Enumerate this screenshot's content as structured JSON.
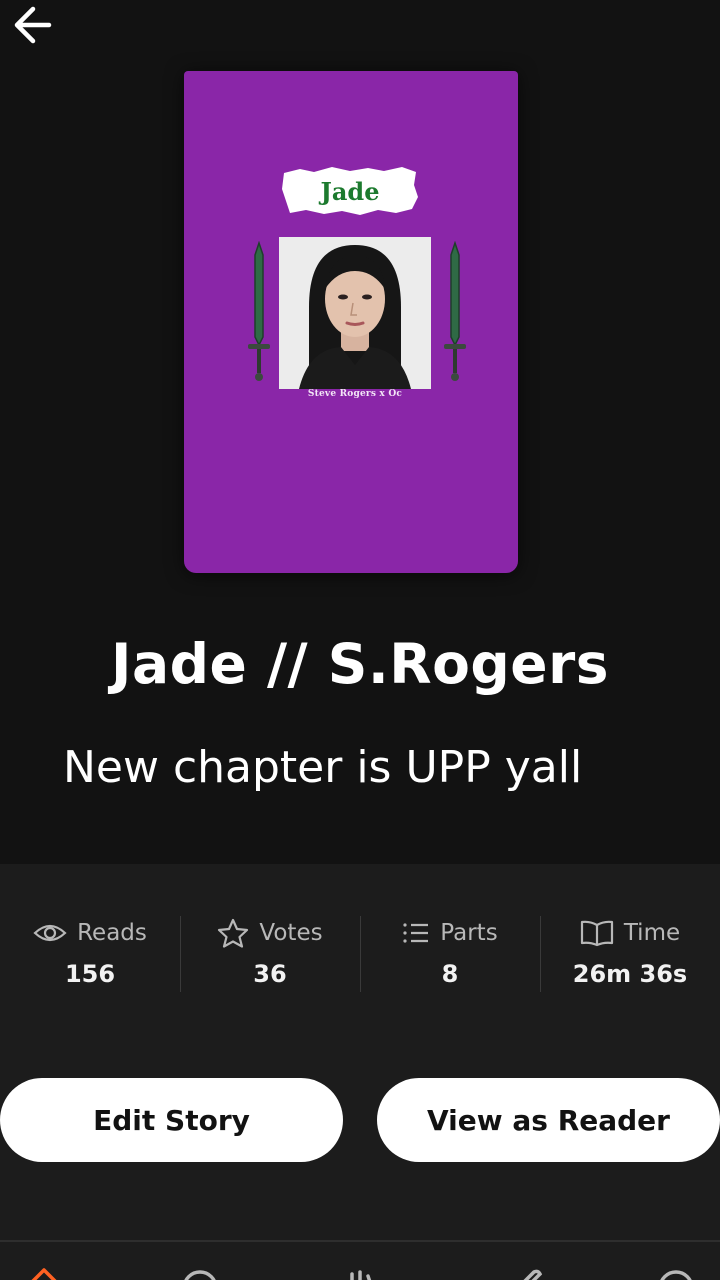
{
  "header": {
    "back_icon": "arrow-left-icon"
  },
  "cover": {
    "title": "Jade",
    "subtitle": "Steve Rogers x Oc",
    "background_color": "#8a26a8",
    "title_color": "#1c7a2e"
  },
  "story": {
    "title": "Jade // S.Rogers",
    "description": "New chapter is UPP yall"
  },
  "stats": [
    {
      "icon": "eye-icon",
      "label": "Reads",
      "value": "156"
    },
    {
      "icon": "star-icon",
      "label": "Votes",
      "value": "36"
    },
    {
      "icon": "list-icon",
      "label": "Parts",
      "value": "8"
    },
    {
      "icon": "book-icon",
      "label": "Time",
      "value": "26m 36s"
    }
  ],
  "actions": {
    "edit_label": "Edit Story",
    "view_label": "View as Reader"
  },
  "nav": {
    "items": [
      "home-icon",
      "search-icon",
      "library-icon",
      "write-icon",
      "profile-icon"
    ],
    "active_color": "#ff6122"
  }
}
